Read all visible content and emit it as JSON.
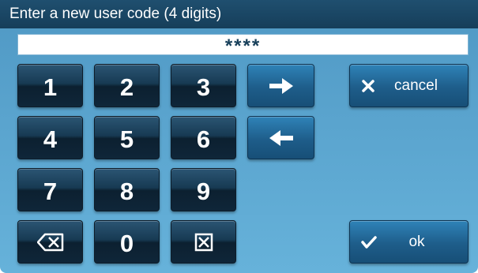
{
  "header": {
    "title": "Enter a new user code (4 digits)"
  },
  "code_field": {
    "value": "****"
  },
  "keypad": {
    "keys": [
      "1",
      "2",
      "3",
      "4",
      "5",
      "6",
      "7",
      "8",
      "9",
      "0"
    ],
    "backspace_icon": "backspace-icon",
    "clear_icon": "clear-icon"
  },
  "nav": {
    "next_icon": "arrow-right-icon",
    "prev_icon": "arrow-left-icon"
  },
  "actions": {
    "cancel_label": "cancel",
    "ok_label": "ok",
    "cancel_icon": "close-icon",
    "ok_icon": "checkmark-icon"
  },
  "colors": {
    "header_bg": "#163e5a",
    "screen_bg": "#5aa4ce",
    "key_dark": "#0f2639",
    "key_blue": "#1e5d8a"
  }
}
